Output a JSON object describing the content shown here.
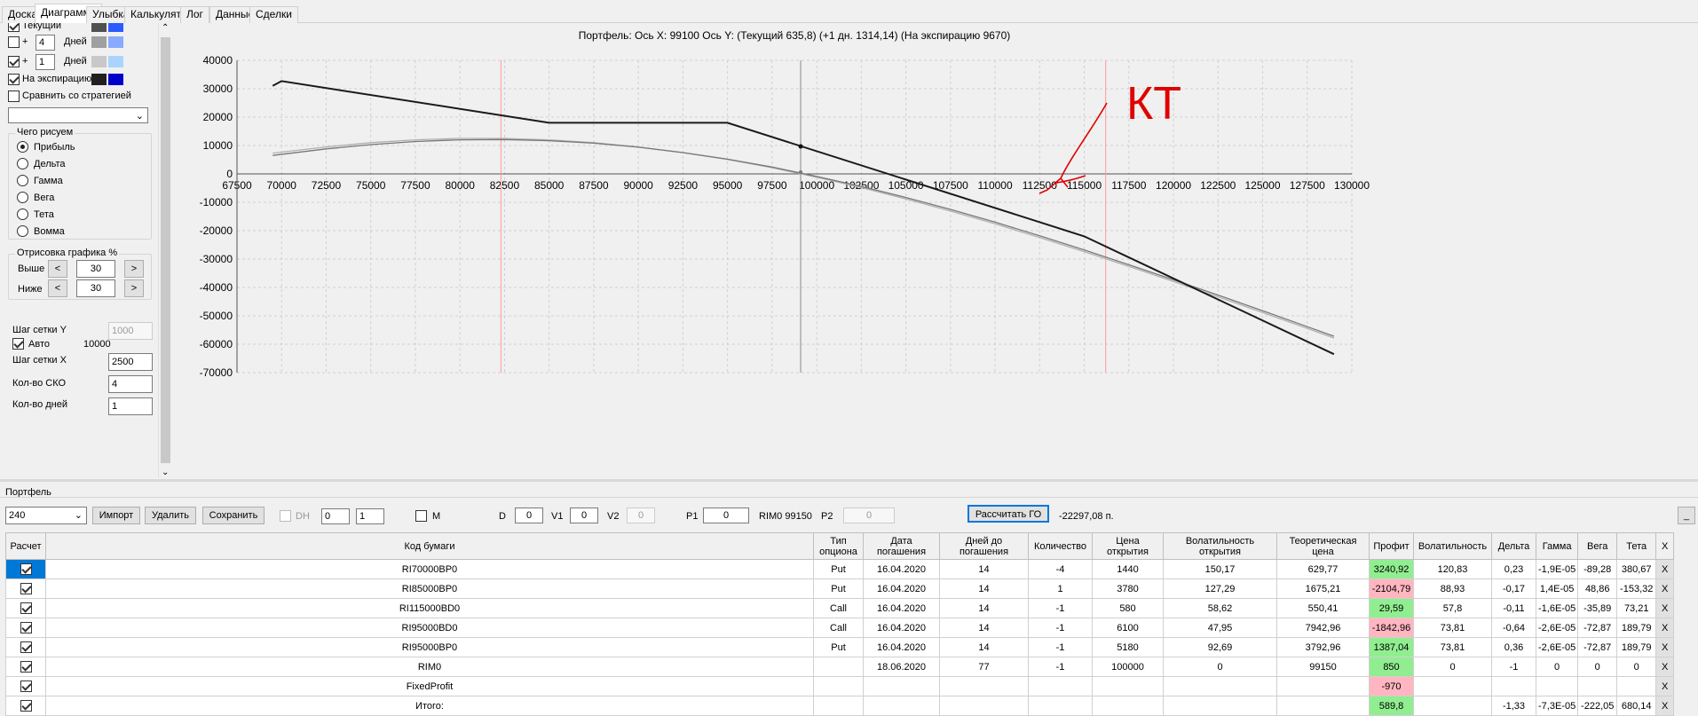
{
  "tabs": [
    "Доска",
    "Диаграмма",
    "Улыбка",
    "Калькулятор",
    "Лог",
    "Данные",
    "Сделки"
  ],
  "active_tab": "Диаграмма",
  "left": {
    "current_label": "Текущий",
    "plus": "+",
    "days_1_value": "4",
    "days_label": "Дней",
    "days_2_value": "1",
    "expiry_label": "На экспирацию",
    "compare_label": "Сравнить со стратегией",
    "what_title": "Чего рисуем",
    "radios": [
      "Прибыль",
      "Дельта",
      "Гамма",
      "Вега",
      "Тета",
      "Вомма"
    ],
    "render_title": "Отрисовка графика %",
    "above_label": "Выше",
    "above_value": "30",
    "below_label": "Ниже",
    "below_value": "30",
    "arrow_left": "<",
    "arrow_right": ">",
    "grid_y_label": "Шаг сетки Y",
    "grid_y_value": "1000",
    "auto_label": "Авто",
    "auto_value": "10000",
    "grid_x_label": "Шаг сетки X",
    "grid_x_value": "2500",
    "sko_label": "Кол-во СКО",
    "sko_value": "4",
    "days_count_label": "Кол-во дней",
    "days_count_value": "1"
  },
  "colors": {
    "swatch_current_1": "#505050",
    "swatch_current_2": "#2b5cff",
    "swatch_d4_1": "#a0a0a0",
    "swatch_d4_2": "#88aaff",
    "swatch_d1_1": "#c8c8c8",
    "swatch_d1_2": "#aad4ff",
    "swatch_exp_1": "#202020",
    "swatch_exp_2": "#0000cc"
  },
  "chart_data": {
    "type": "line",
    "title": "Портфель: Ось X: 99100 Ось Y:  (Текущий 635,8)  (+1 дн. 1314,14)  (На экспирацию 9670)",
    "xlim": [
      67500,
      130000
    ],
    "ylim": [
      -70000,
      40000
    ],
    "x_ticks": [
      "67500",
      "70000",
      "72500",
      "75000",
      "77500",
      "80000",
      "82500",
      "85000",
      "87500",
      "90000",
      "92500",
      "95000",
      "97500",
      "100000",
      "102500",
      "105000",
      "107500",
      "110000",
      "112500",
      "115000",
      "117500",
      "120000",
      "122500",
      "125000",
      "127500",
      "130000"
    ],
    "y_ticks": [
      "40000",
      "30000",
      "20000",
      "10000",
      "0",
      "-10000",
      "-20000",
      "-30000",
      "-40000",
      "-50000",
      "-60000",
      "-70000"
    ],
    "cursor_x": 99100,
    "vlines_red": [
      82300,
      116200
    ],
    "annotation": "КТ",
    "series": [
      {
        "style": "expiry",
        "color": "#1a1a1a",
        "points": [
          [
            69500,
            31000
          ],
          [
            70000,
            32700
          ],
          [
            85000,
            18000
          ],
          [
            95000,
            18000
          ],
          [
            115000,
            -22000
          ],
          [
            129000,
            -63500
          ]
        ]
      },
      {
        "style": "current",
        "color": "#777777",
        "points": [
          [
            69500,
            6500
          ],
          [
            72500,
            8800
          ],
          [
            75000,
            10300
          ],
          [
            77500,
            11400
          ],
          [
            80000,
            12000
          ],
          [
            82500,
            12100
          ],
          [
            85000,
            11700
          ],
          [
            87500,
            10800
          ],
          [
            90000,
            9400
          ],
          [
            92500,
            7500
          ],
          [
            95000,
            5200
          ],
          [
            97500,
            2400
          ],
          [
            100000,
            -900
          ],
          [
            102500,
            -4400
          ],
          [
            105000,
            -8300
          ],
          [
            107500,
            -12500
          ],
          [
            110000,
            -17000
          ],
          [
            112500,
            -21800
          ],
          [
            115000,
            -26800
          ],
          [
            117500,
            -32000
          ],
          [
            120000,
            -37300
          ],
          [
            122500,
            -42700
          ],
          [
            125000,
            -48200
          ],
          [
            127500,
            -53800
          ],
          [
            129000,
            -57200
          ]
        ]
      },
      {
        "style": "plus1",
        "color": "#b0b0b0",
        "points": [
          [
            69500,
            7300
          ],
          [
            72500,
            9500
          ],
          [
            75000,
            11000
          ],
          [
            77500,
            12000
          ],
          [
            80000,
            12500
          ],
          [
            82500,
            12500
          ],
          [
            85000,
            12000
          ],
          [
            87500,
            11000
          ],
          [
            90000,
            9500
          ],
          [
            92500,
            7500
          ],
          [
            95000,
            5100
          ],
          [
            97500,
            2200
          ],
          [
            100000,
            -1200
          ],
          [
            102500,
            -4800
          ],
          [
            105000,
            -8800
          ],
          [
            107500,
            -13100
          ],
          [
            110000,
            -17600
          ],
          [
            112500,
            -22400
          ],
          [
            115000,
            -27400
          ],
          [
            117500,
            -32600
          ],
          [
            120000,
            -37900
          ],
          [
            122500,
            -43300
          ],
          [
            125000,
            -48800
          ],
          [
            127500,
            -54400
          ],
          [
            129000,
            -57800
          ]
        ]
      }
    ]
  },
  "portfolio": {
    "title": "Портфель",
    "select_value": "240",
    "import": "Импорт",
    "delete": "Удалить",
    "save": "Сохранить",
    "dh": "DH",
    "spin1": "0",
    "spin2": "1",
    "m": "M",
    "d_label": "D",
    "d_value": "0",
    "v1_label": "V1",
    "v1_value": "0",
    "v2_label": "V2",
    "v2_value": "0",
    "p1_label": "P1",
    "p1_value": "0",
    "rim_label": "RIM0 99150",
    "p2_label": "P2",
    "p2_value": "0",
    "calc_go": "Рассчитать ГО",
    "go_value": "-22297,08 п.",
    "small_btn": "_"
  },
  "table": {
    "headers": [
      "Расчет",
      "Код бумаги",
      "Тип опциона",
      "Дата погашения",
      "Дней до погашения",
      "Количество",
      "Цена открытия",
      "Волатильность открытия",
      "Теоретическая цена",
      "Профит",
      "Волатильность",
      "Дельта",
      "Гамма",
      "Вега",
      "Тета",
      "X"
    ],
    "rows": [
      [
        "",
        "RI70000BP0",
        "Put",
        "16.04.2020",
        "14",
        "-4",
        "1440",
        "150,17",
        "629,77",
        "3240,92",
        "120,83",
        "0,23",
        "-1,9E-05",
        "-89,28",
        "380,67",
        "X"
      ],
      [
        "",
        "RI85000BP0",
        "Put",
        "16.04.2020",
        "14",
        "1",
        "3780",
        "127,29",
        "1675,21",
        "-2104,79",
        "88,93",
        "-0,17",
        "1,4E-05",
        "48,86",
        "-153,32",
        "X"
      ],
      [
        "",
        "RI115000BD0",
        "Call",
        "16.04.2020",
        "14",
        "-1",
        "580",
        "58,62",
        "550,41",
        "29,59",
        "57,8",
        "-0,11",
        "-1,6E-05",
        "-35,89",
        "73,21",
        "X"
      ],
      [
        "",
        "RI95000BD0",
        "Call",
        "16.04.2020",
        "14",
        "-1",
        "6100",
        "47,95",
        "7942,96",
        "-1842,96",
        "73,81",
        "-0,64",
        "-2,6E-05",
        "-72,87",
        "189,79",
        "X"
      ],
      [
        "",
        "RI95000BP0",
        "Put",
        "16.04.2020",
        "14",
        "-1",
        "5180",
        "92,69",
        "3792,96",
        "1387,04",
        "73,81",
        "0,36",
        "-2,6E-05",
        "-72,87",
        "189,79",
        "X"
      ],
      [
        "",
        "RIM0",
        "",
        "18.06.2020",
        "77",
        "-1",
        "100000",
        "0",
        "99150",
        "850",
        "0",
        "-1",
        "0",
        "0",
        "0",
        "X"
      ],
      [
        "",
        "FixedProfit",
        "",
        "",
        "",
        "",
        "",
        "",
        "",
        "-970",
        "",
        "",
        "",
        "",
        "",
        "X"
      ],
      [
        "",
        "Итого:",
        "",
        "",
        "",
        "",
        "",
        "",
        "",
        "589,8",
        "",
        "-1,33",
        "-7,3E-05",
        "-222,05",
        "680,14",
        "X"
      ]
    ],
    "profit_colors": [
      "green",
      "pink",
      "green",
      "pink",
      "green",
      "green",
      "pink",
      "green"
    ]
  }
}
